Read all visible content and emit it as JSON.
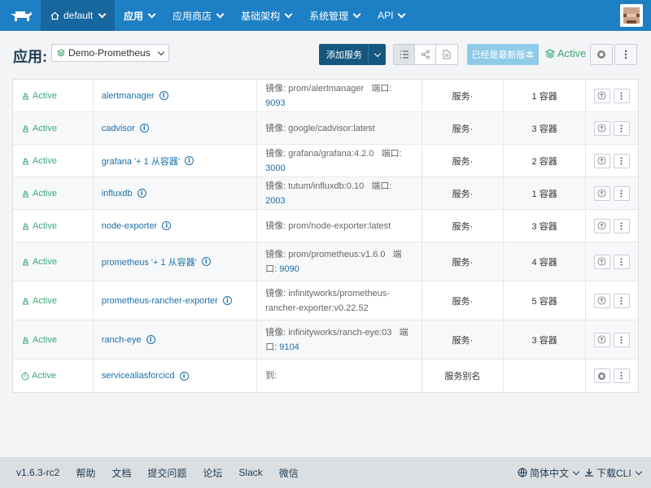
{
  "nav": {
    "env": "default",
    "items": [
      {
        "label": "应用",
        "active": true
      },
      {
        "label": "应用商店",
        "active": false
      },
      {
        "label": "基础架构",
        "active": false
      },
      {
        "label": "系统管理",
        "active": false
      },
      {
        "label": "API",
        "active": false
      }
    ]
  },
  "header": {
    "title": "应用:",
    "stack": "Demo-Prometheus",
    "add_service": "添加服务",
    "upgrade": "已经是最新版本",
    "state": "Active"
  },
  "services": [
    {
      "state": "Active",
      "name": "alertmanager",
      "image": "镜像: prom/alertmanager",
      "port_label": "端口:",
      "port": "9093",
      "type": "服务·",
      "scale": "1 容器",
      "icon": "stop"
    },
    {
      "state": "Active",
      "name": "cadvisor",
      "image": "镜像: google/cadvisor:latest",
      "port_label": "",
      "port": "",
      "type": "服务·",
      "scale": "3 容器",
      "icon": "stop"
    },
    {
      "state": "Active",
      "name": "grafana '+ 1 从容器'",
      "image": "镜像: grafana/grafana:4.2.0",
      "port_label": "端口:",
      "port": "3000",
      "type": "服务·",
      "scale": "2 容器",
      "icon": "stop"
    },
    {
      "state": "Active",
      "name": "influxdb",
      "image": "镜像: tutum/influxdb:0.10",
      "port_label": "端口:",
      "port": "2003",
      "type": "服务·",
      "scale": "1 容器",
      "icon": "stop"
    },
    {
      "state": "Active",
      "name": "node-exporter",
      "image": "镜像: prom/node-exporter:latest",
      "port_label": "",
      "port": "",
      "type": "服务·",
      "scale": "3 容器",
      "icon": "stop"
    },
    {
      "state": "Active",
      "name": "prometheus '+ 1 从容器'",
      "image": "镜像: prom/prometheus:v1.6.0",
      "port_label": "端口:",
      "port": "9090",
      "type": "服务·",
      "scale": "4 容器",
      "icon": "stop"
    },
    {
      "state": "Active",
      "name": "prometheus-rancher-exporter",
      "image": "镜像: infinityworks/prometheus-rancher-exporter:v0.22.52",
      "port_label": "",
      "port": "",
      "type": "服务·",
      "scale": "5 容器",
      "icon": "stop"
    },
    {
      "state": "Active",
      "name": "ranch-eye",
      "image": "镜像: infinityworks/ranch-eye:03",
      "port_label": "端口:",
      "port": "9104",
      "type": "服务·",
      "scale": "3 容器",
      "icon": "stop"
    },
    {
      "state": "Active",
      "name": "servicealiasforcicd",
      "image": "到:",
      "port_label": "",
      "port": "",
      "type": "服务别名",
      "scale": "",
      "icon": "record"
    }
  ],
  "footer": {
    "version": "v1.6.3-rc2",
    "links": [
      "帮助",
      "文档",
      "提交问题",
      "论坛",
      "Slack",
      "微信"
    ],
    "language": "简体中文",
    "download": "下载CLI"
  }
}
